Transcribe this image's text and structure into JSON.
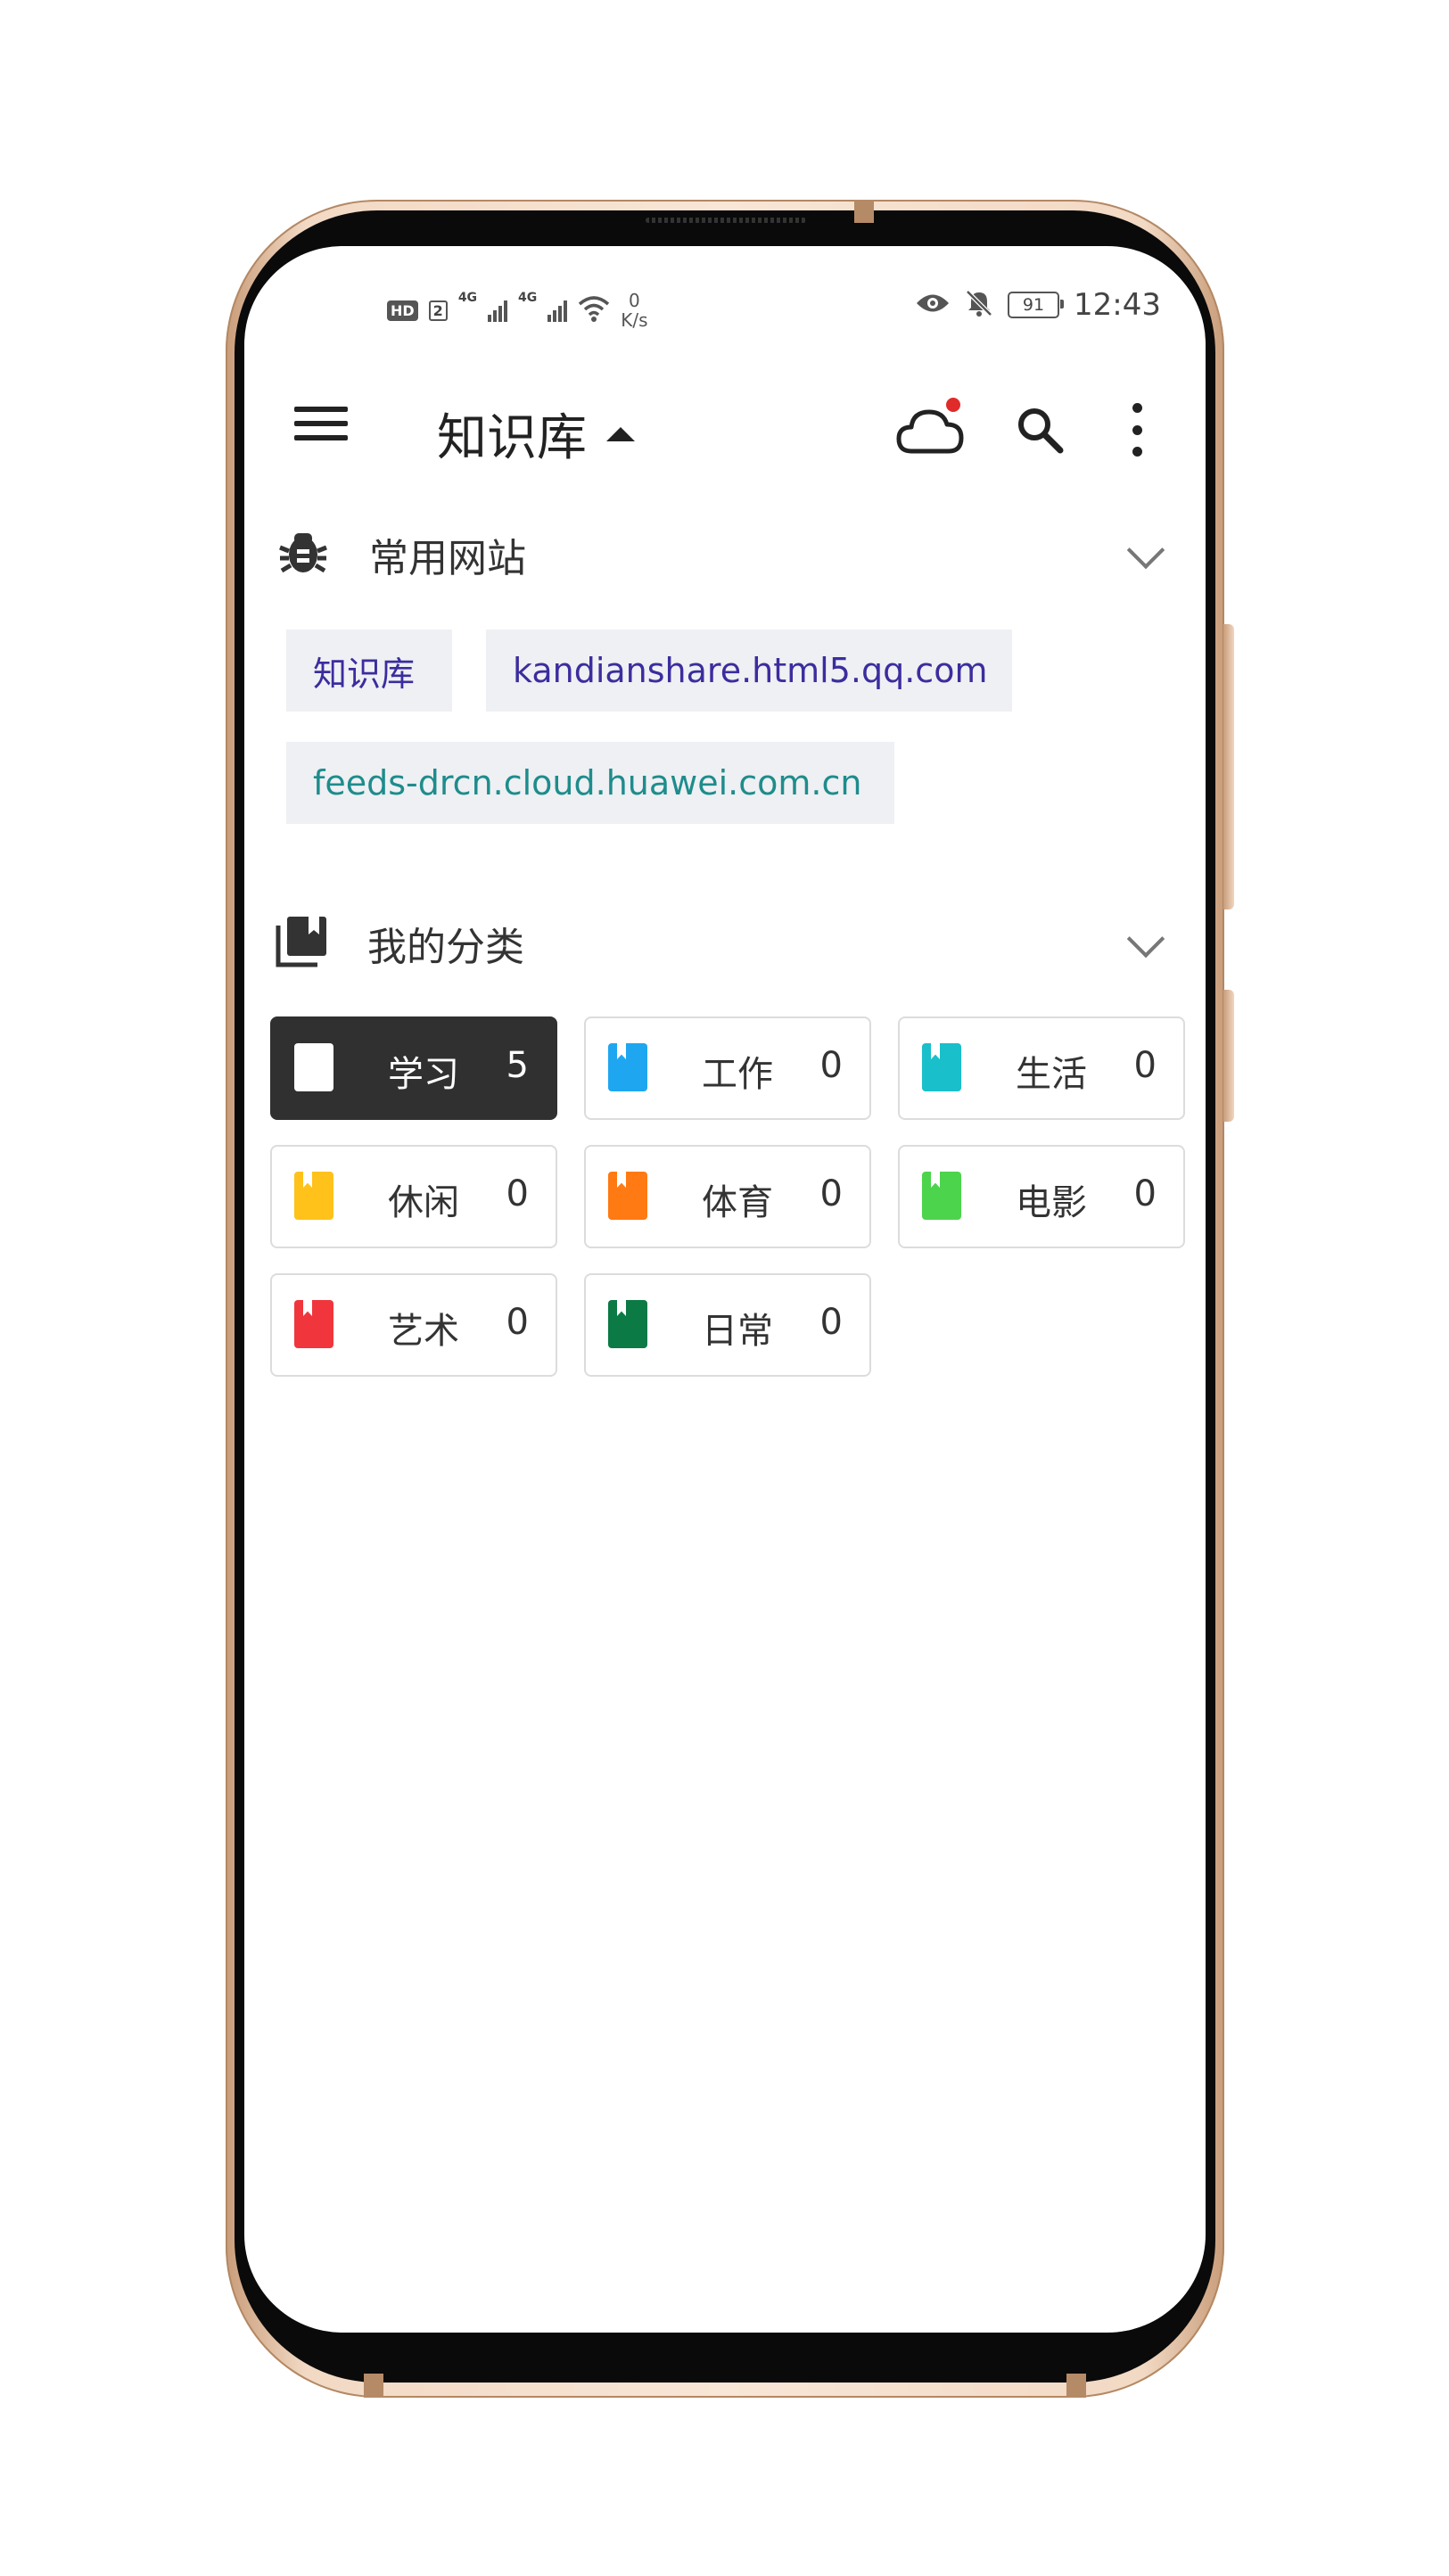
{
  "status_bar": {
    "hd": "HD",
    "sim": "2",
    "net1": "4G",
    "net2": "4G",
    "speed_value": "0",
    "speed_unit": "K/s",
    "battery": "91",
    "time": "12:43"
  },
  "header": {
    "title": "知识库"
  },
  "sites_section": {
    "title": "常用网站",
    "chips": [
      {
        "label": "知识库",
        "color": "#3b2d9e"
      },
      {
        "label": "kandianshare.html5.qq.com",
        "color": "#3b2d9e"
      },
      {
        "label": "feeds-drcn.cloud.huawei.com.cn",
        "color": "#1e8c8c"
      }
    ]
  },
  "categories_section": {
    "title": "我的分类",
    "items": [
      {
        "label": "学习",
        "count": "5",
        "color": "#ffffff",
        "active": true
      },
      {
        "label": "工作",
        "count": "0",
        "color": "#1ea7f0"
      },
      {
        "label": "生活",
        "count": "0",
        "color": "#19bfca"
      },
      {
        "label": "休闲",
        "count": "0",
        "color": "#ffc21a"
      },
      {
        "label": "体育",
        "count": "0",
        "color": "#ff7a12"
      },
      {
        "label": "电影",
        "count": "0",
        "color": "#4cd44c"
      },
      {
        "label": "艺术",
        "count": "0",
        "color": "#f0363c"
      },
      {
        "label": "日常",
        "count": "0",
        "color": "#0b7a45"
      }
    ]
  }
}
